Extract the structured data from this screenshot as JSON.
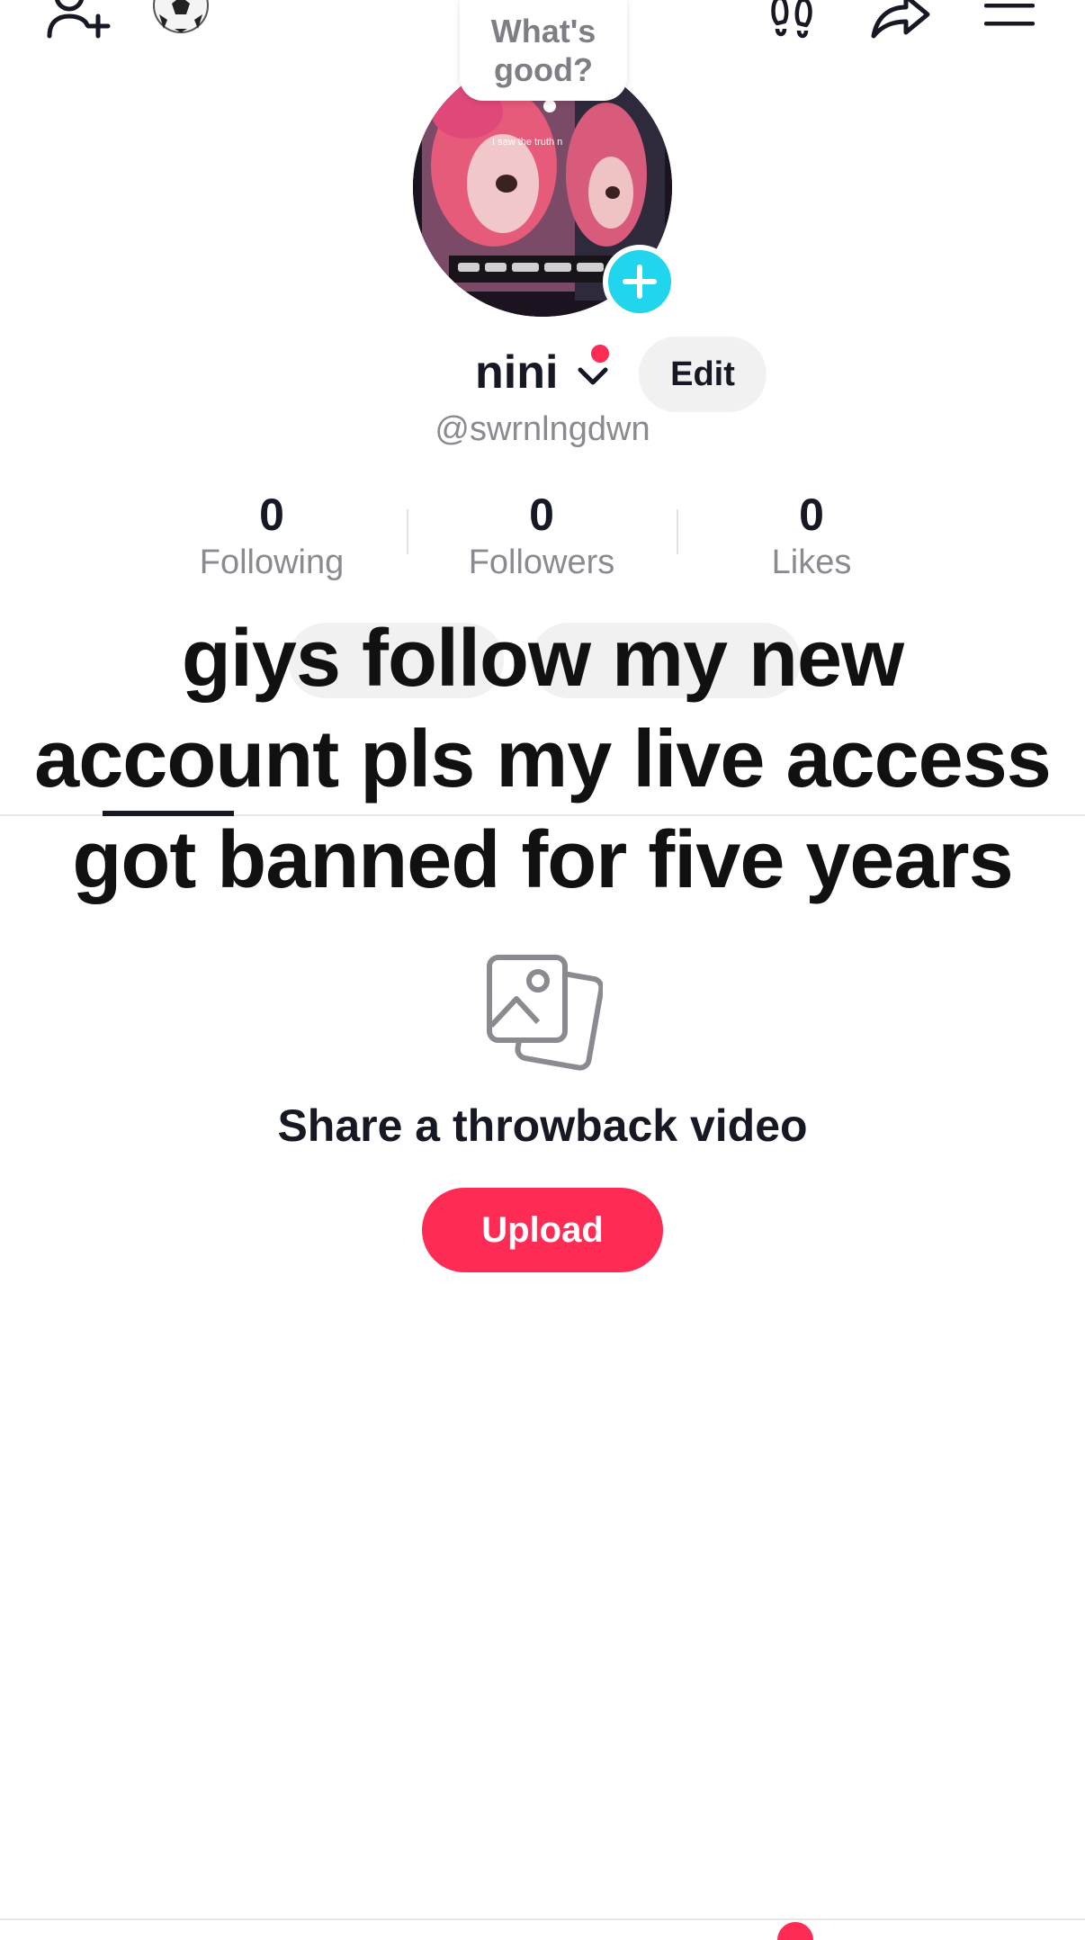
{
  "topbar": {
    "add_friend_icon": "person-plus-icon",
    "soccer_icon": "soccer-ball-icon",
    "footprints_icon": "footprints-icon",
    "share_icon": "share-arrow-icon",
    "menu_icon": "hamburger-menu-icon"
  },
  "bubble": {
    "text": "What's good?"
  },
  "profile": {
    "avatar_caption": "I saw the truth n",
    "name": "nini",
    "handle": "@swrnlngdwn",
    "edit_label": "Edit",
    "notification_color": "#fe2c55"
  },
  "stats": [
    {
      "value": "0",
      "label": "Following"
    },
    {
      "value": "0",
      "label": "Followers"
    },
    {
      "value": "0",
      "label": "Likes"
    }
  ],
  "overlay": {
    "line1": "giys follow my new",
    "line2": "account pls my live access",
    "line3": "got banned for five years"
  },
  "empty_state": {
    "icon": "photos-icon",
    "title": "Share a throwback video",
    "upload_label": "Upload"
  },
  "colors": {
    "accent": "#fe2c55",
    "badge": "#20d5ec",
    "muted": "#8a8b91"
  }
}
